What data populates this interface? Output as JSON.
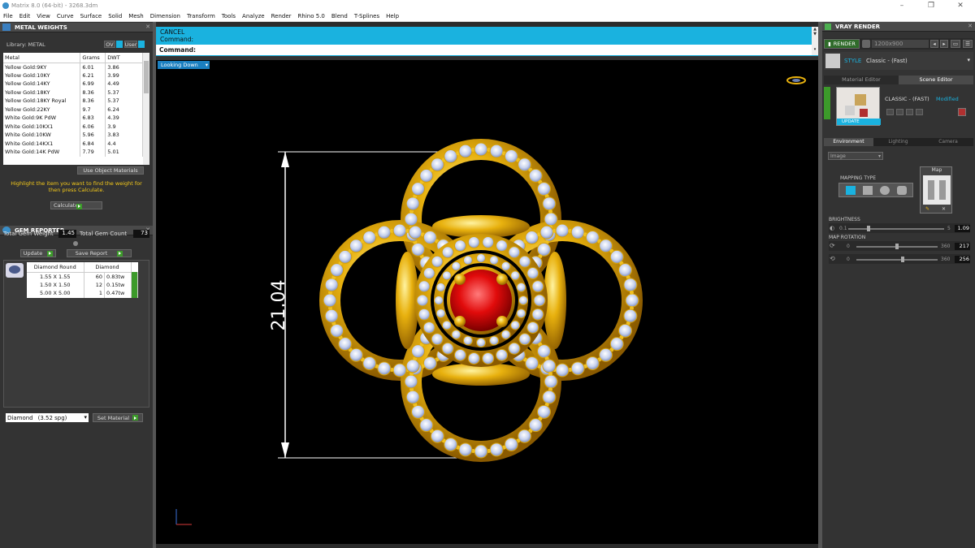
{
  "window": {
    "title": "Matrix 8.0 (64-bit) - 3268.3dm"
  },
  "menu": [
    "File",
    "Edit",
    "View",
    "Curve",
    "Surface",
    "Solid",
    "Mesh",
    "Dimension",
    "Transform",
    "Tools",
    "Analyze",
    "Render",
    "Rhino 5.0",
    "Blend",
    "T-Splines",
    "Help"
  ],
  "metal_weights": {
    "title": "METAL WEIGHTS",
    "library_label": "Library: METAL",
    "btn_ov": "OV",
    "btn_user": "User",
    "columns": [
      "Metal",
      "Grams",
      "DWT"
    ],
    "rows": [
      [
        "Yellow Gold:9KY",
        "6.01",
        "3.86"
      ],
      [
        "Yellow Gold:10KY",
        "6.21",
        "3.99"
      ],
      [
        "Yellow Gold:14KY",
        "6.99",
        "4.49"
      ],
      [
        "Yellow Gold:18KY",
        "8.36",
        "5.37"
      ],
      [
        "Yellow Gold:18KY Royal",
        "8.36",
        "5.37"
      ],
      [
        "Yellow Gold:22KY",
        "9.7",
        "6.24"
      ],
      [
        "White Gold:9K PdW",
        "6.83",
        "4.39"
      ],
      [
        "White Gold:10KX1",
        "6.06",
        "3.9"
      ],
      [
        "White Gold:10KW",
        "5.96",
        "3.83"
      ],
      [
        "White Gold:14KX1",
        "6.84",
        "4.4"
      ],
      [
        "White Gold:14K PdW",
        "7.79",
        "5.01"
      ]
    ],
    "use_object_materials": "Use Object Materials",
    "hint": "Highlight the item you want to find the weight for then press Calculate.",
    "calculate": "Calculate"
  },
  "gem_reporter": {
    "title": "GEM REPORTER",
    "total_gem_weight_label": "Total Gem Weight",
    "total_gem_weight": "1.45",
    "total_gem_count_label": "Total Gem Count",
    "total_gem_count": "73",
    "update": "Update",
    "save_report": "Save Report",
    "header_shape": "Diamond Round",
    "header_material": "Diamond",
    "rows": [
      [
        "1.55 X 1.55",
        "60",
        "0.83tw"
      ],
      [
        "1.50 X 1.50",
        "12",
        "0.15tw"
      ],
      [
        "5.00 X 5.00",
        "1",
        "0.47tw"
      ]
    ],
    "material_select": "Diamond",
    "material_sg": "(3.52 spg)",
    "set_material": "Set Material"
  },
  "command": {
    "line1": "CANCEL",
    "line2": "Command:",
    "prompt": "Command:"
  },
  "viewport": {
    "view_name": "Looking Down",
    "dimension": "21.04"
  },
  "vray": {
    "title": "VRAY RENDER",
    "render": "RENDER",
    "resolution": "1200x900",
    "style_label": "STYLE",
    "style_value": "Classic - (Fast)",
    "tab_material": "Material Editor",
    "tab_scene": "Scene Editor",
    "preset_name": "CLASSIC - (FAST)",
    "preset_modified": "Modified",
    "update": "UPDATE",
    "subtabs": [
      "Environment",
      "Lighting",
      "Camera"
    ],
    "env_select": "Image",
    "mapping_type": "MAPPING TYPE",
    "map_label": "Map",
    "brightness_label": "BRIGHTNESS",
    "brightness_min": "0.1",
    "brightness_max": "5",
    "brightness_value": "1.09",
    "brightness_level": 0.2,
    "map_rotation_label": "MAP ROTATION",
    "rot1_min": "0",
    "rot1_max": "360",
    "rot1_value": "217",
    "rot2_min": "0",
    "rot2_max": "360",
    "rot2_value": "256"
  },
  "colors": {
    "accent_blue": "#1ab2df",
    "gold": "#e8b10e",
    "ruby": "#e10b0b",
    "green": "#3c9a2a"
  }
}
